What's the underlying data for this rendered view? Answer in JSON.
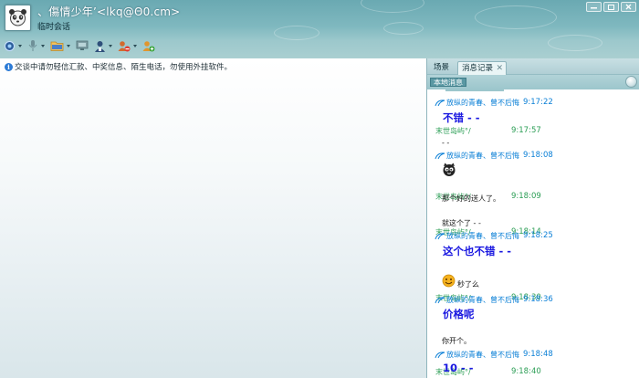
{
  "header": {
    "contact_name": "、傷情少年’<lkq@Θ0.cm>",
    "session_type": "临时会话"
  },
  "notice": {
    "text": "交谈中请勿轻信汇款、中奖信息、陌生电话，勿使用外挂软件。"
  },
  "panel": {
    "tabs": [
      {
        "label": "场景"
      },
      {
        "label": "消息记录"
      }
    ],
    "local_messages_label": "本地消息"
  },
  "log": [
    {
      "kind": "sender",
      "who": "other",
      "name": "放纵的青春、曾不后悔",
      "time": "9:17:22"
    },
    {
      "kind": "message",
      "style": "big",
      "text": "不错 - -"
    },
    {
      "kind": "sender",
      "who": "me",
      "name": "末世岛屿°/",
      "time": "9:17:57"
    },
    {
      "kind": "message",
      "style": "small",
      "text": "- -"
    },
    {
      "kind": "sender",
      "who": "other",
      "name": "放纵的青春、曾不后悔",
      "time": "9:18:08"
    },
    {
      "kind": "emote",
      "icon": "cat-face-emoticon"
    },
    {
      "kind": "sender",
      "who": "me",
      "name": "末世岛屿°/",
      "time": "9:18:09"
    },
    {
      "kind": "message",
      "style": "small",
      "text": "那个好的送人了。"
    },
    {
      "kind": "sender",
      "who": "me",
      "name": "末世岛屿°/",
      "time": "9:18:14"
    },
    {
      "kind": "message",
      "style": "small",
      "text": "就这个了  - -"
    },
    {
      "kind": "sender",
      "who": "other",
      "name": "放纵的青春、曾不后悔",
      "time": "9:18:25"
    },
    {
      "kind": "message",
      "style": "big",
      "text": "这个也不错 - -"
    },
    {
      "kind": "sender",
      "who": "me",
      "name": "末世岛屿°/",
      "time": "9:18:30"
    },
    {
      "kind": "emote_text",
      "icon": "smiley-emoticon",
      "text": "秒了么"
    },
    {
      "kind": "sender",
      "who": "other",
      "name": "放纵的青春、曾不后悔",
      "time": "9:18:36"
    },
    {
      "kind": "message",
      "style": "big",
      "text": "价格呢"
    },
    {
      "kind": "sender",
      "who": "me",
      "name": "末世岛屿°/",
      "time": "9:18:40"
    },
    {
      "kind": "message",
      "style": "small",
      "text": "你开个。"
    },
    {
      "kind": "sender",
      "who": "other",
      "name": "放纵的青春、曾不后悔",
      "time": "9:18:48"
    },
    {
      "kind": "message",
      "style": "big",
      "text": "10 - -"
    }
  ],
  "colors": {
    "other_name": "#0a7fd6",
    "me_name": "#2a9d54",
    "big_message": "#1a18e0"
  }
}
